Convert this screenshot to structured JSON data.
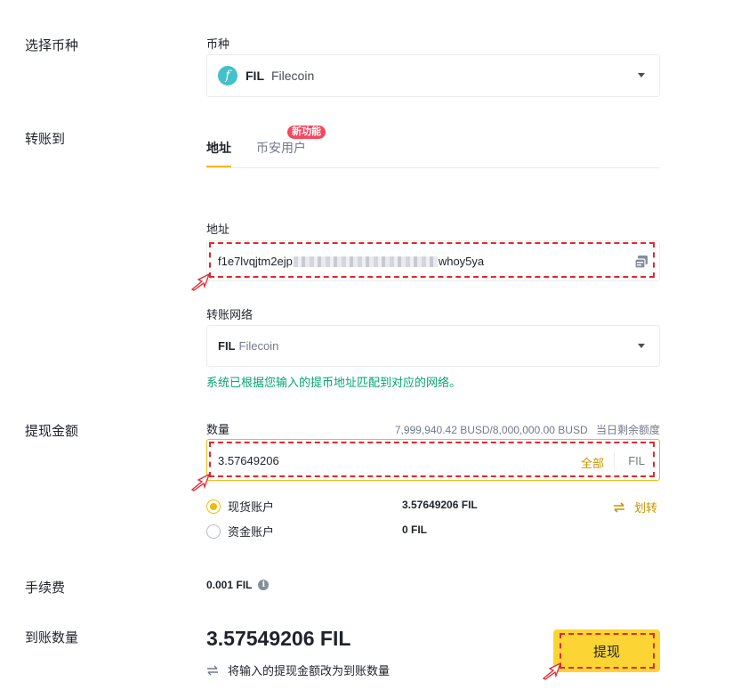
{
  "sections": {
    "coin": "选择币种",
    "transfer_to": "转账到",
    "withdraw_amount": "提现金额",
    "fee": "手续费",
    "receive_amount": "到账数量"
  },
  "coin_select": {
    "label": "币种",
    "symbol": "FIL",
    "name": "Filecoin",
    "logo_glyph": "f",
    "logo_color": "#42c1ca"
  },
  "tabs": [
    {
      "label": "地址",
      "active": true
    },
    {
      "label": "币安用户",
      "active": false,
      "badge": "新功能"
    }
  ],
  "address": {
    "label": "地址",
    "value_prefix": "f1e7lvqjtm2ejp",
    "value_suffix": "whoy5ya",
    "paste_icon": "clipboard-icon"
  },
  "network": {
    "label": "转账网络",
    "symbol": "FIL",
    "name": "Filecoin",
    "hint": "系统已根据您输入的提币地址匹配到对应的网络。"
  },
  "amount": {
    "label": "数量",
    "limit_text": "7,999,940.42 BUSD/8,000,000.00 BUSD",
    "limit_label": "当日剩余额度",
    "value": "3.57649206",
    "all_label": "全部",
    "unit": "FIL"
  },
  "accounts": [
    {
      "label": "现货账户",
      "balance": "3.57649206 FIL",
      "selected": true
    },
    {
      "label": "资金账户",
      "balance": "0 FIL",
      "selected": false
    }
  ],
  "transfer_link": "划转",
  "fee_value": "0.001 FIL",
  "receive": {
    "value": "3.57549206 FIL",
    "toggle_text": "将输入的提现金额改为到账数量"
  },
  "submit_label": "提现",
  "colors": {
    "accent": "#f0b90b",
    "hint_green": "#03a66d",
    "badge_red": "#f6465d",
    "annotation_red": "#e2272f"
  }
}
